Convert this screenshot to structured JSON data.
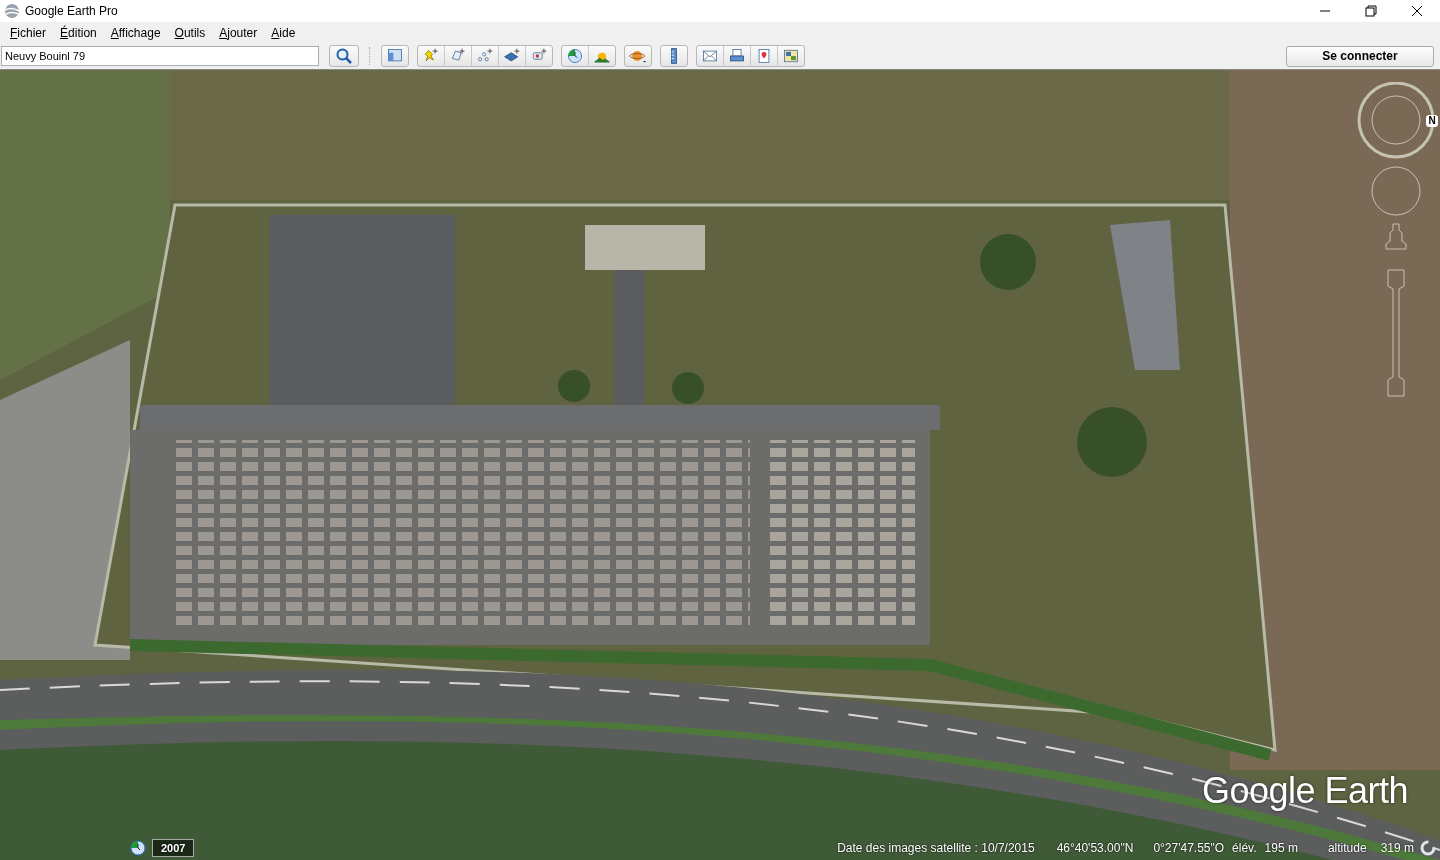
{
  "window": {
    "title": "Google Earth Pro"
  },
  "menu": [
    {
      "label": "Fichier"
    },
    {
      "label": "Édition"
    },
    {
      "label": "Affichage"
    },
    {
      "label": "Outils"
    },
    {
      "label": "Ajouter"
    },
    {
      "label": "Aide"
    }
  ],
  "toolbar": {
    "search": {
      "value": "Neuvy Bouinl 79"
    },
    "sign_in": "Se connecter"
  },
  "map": {
    "compass_label": "N",
    "logo": "Google Earth",
    "historical_year": "2007"
  },
  "status_bar": {
    "imagery_date": "Date des images satellite : 10/7/2015",
    "latitude": "46°40'53.00\"N",
    "longitude": "0°27'47.55\"O",
    "elevation_label": "élév.",
    "elevation": "195 m",
    "altitude_label": "altitude",
    "altitude": "319 m"
  }
}
